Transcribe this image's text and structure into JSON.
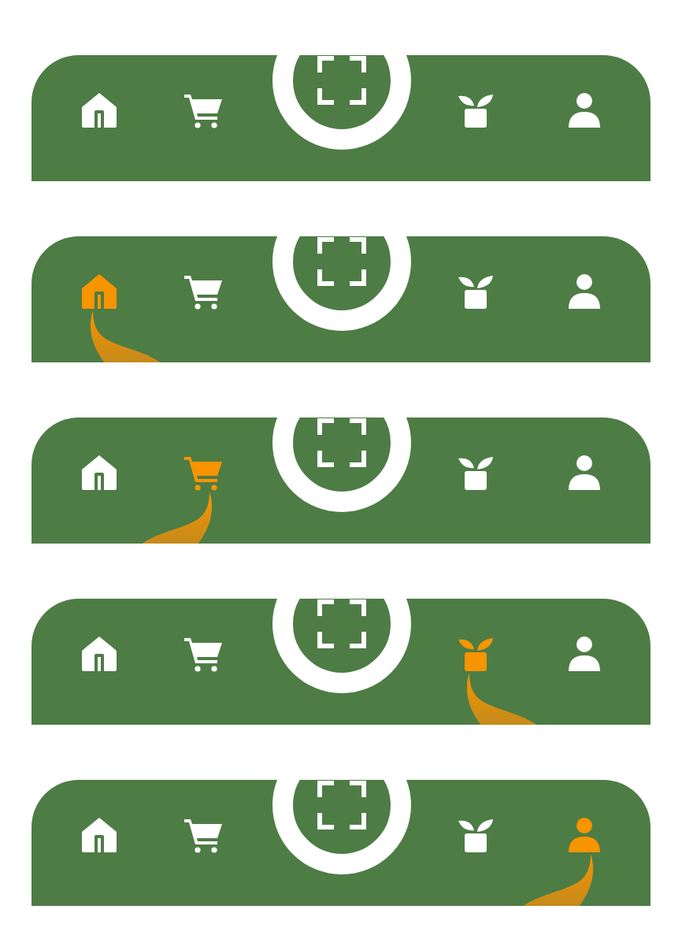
{
  "nav_bars": [
    {
      "items": [
        {
          "kind": "home",
          "selected": false
        },
        {
          "kind": "cart",
          "selected": false
        },
        {
          "kind": "plant",
          "selected": false
        },
        {
          "kind": "person",
          "selected": false
        }
      ]
    },
    {
      "items": [
        {
          "kind": "home",
          "selected": true
        },
        {
          "kind": "cart",
          "selected": false
        },
        {
          "kind": "plant",
          "selected": false
        },
        {
          "kind": "person",
          "selected": false
        }
      ]
    },
    {
      "items": [
        {
          "kind": "home",
          "selected": false
        },
        {
          "kind": "cart",
          "selected": true
        },
        {
          "kind": "plant",
          "selected": false
        },
        {
          "kind": "person",
          "selected": false
        }
      ]
    },
    {
      "items": [
        {
          "kind": "home",
          "selected": false
        },
        {
          "kind": "cart",
          "selected": false
        },
        {
          "kind": "plant",
          "selected": true
        },
        {
          "kind": "person",
          "selected": false
        }
      ]
    },
    {
      "items": [
        {
          "kind": "home",
          "selected": false
        },
        {
          "kind": "cart",
          "selected": false
        },
        {
          "kind": "plant",
          "selected": false
        },
        {
          "kind": "person",
          "selected": true
        }
      ]
    }
  ]
}
